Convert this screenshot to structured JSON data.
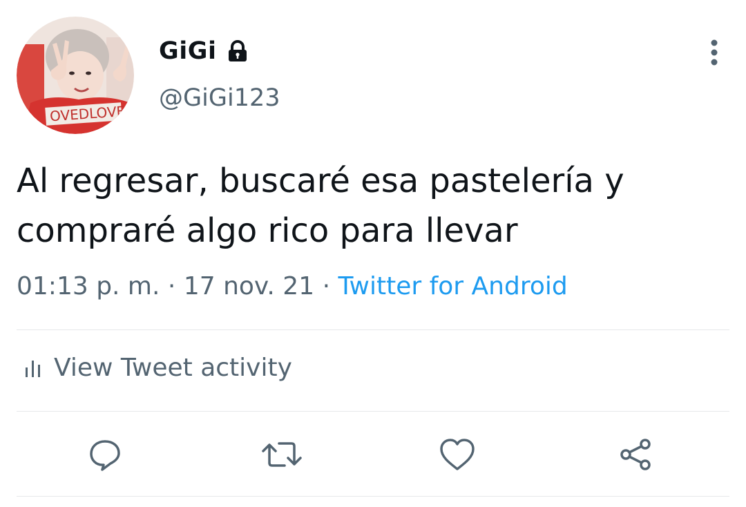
{
  "user": {
    "display_name": "GiGi",
    "handle": "@GiGi123",
    "avatar": "profile-photo",
    "avatar_shirt_text": "OVEDLOVE",
    "protected_icon": "lock-icon"
  },
  "tweet": {
    "text_line1": "Al regresar, buscaré esa pastelería y",
    "text_line2": "compraré algo rico para llevar",
    "time": "01:13 p. m.",
    "separator": "·",
    "date": "17 nov. 21",
    "source": "Twitter for Android"
  },
  "activity": {
    "label": "View Tweet activity",
    "icon": "bar-chart-icon"
  },
  "actions": [
    {
      "name": "reply",
      "icon": "reply-icon"
    },
    {
      "name": "retweet",
      "icon": "retweet-icon"
    },
    {
      "name": "like",
      "icon": "heart-icon"
    },
    {
      "name": "share",
      "icon": "share-icon"
    }
  ],
  "colors": {
    "text": "#0f1419",
    "secondary": "#536471",
    "link": "#1d9bf0",
    "divider": "#e6e8ea",
    "icon": "#536471"
  }
}
